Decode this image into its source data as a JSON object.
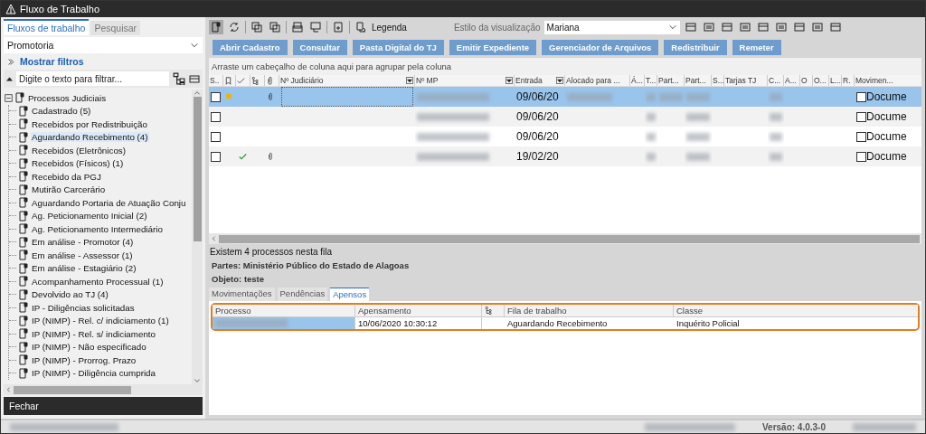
{
  "window": {
    "title": "Fluxo de Trabalho"
  },
  "left_panel": {
    "tabs": [
      {
        "label": "Fluxos de trabalho",
        "selected": true
      },
      {
        "label": "Pesquisar",
        "selected": false
      }
    ],
    "queue_select": {
      "value": "Promotoria"
    },
    "filters_link": "Mostrar filtros",
    "filter_field": {
      "placeholder": "Digite o texto para filtrar..."
    },
    "tree": {
      "label": "Processos Judiciais",
      "expanded": true,
      "children": [
        {
          "label": "Cadastrado (5)",
          "selected": false
        },
        {
          "label": "Recebidos por Redistribuição",
          "selected": false
        },
        {
          "label": "Aguardando Recebimento (4)",
          "selected": true
        },
        {
          "label": "Recebidos (Eletrônicos)",
          "selected": false
        },
        {
          "label": "Recebidos (Físicos) (1)",
          "selected": false
        },
        {
          "label": "Recebido da PGJ",
          "selected": false
        },
        {
          "label": "Mutirão Carcerário",
          "selected": false
        },
        {
          "label": "Aguardando Portaria de Atuação Conju",
          "selected": false
        },
        {
          "label": "Ag. Peticionamento Inicial (2)",
          "selected": false
        },
        {
          "label": "Ag. Peticionamento Intermediário",
          "selected": false
        },
        {
          "label": "Em análise - Promotor (4)",
          "selected": false
        },
        {
          "label": "Em análise - Assessor (1)",
          "selected": false
        },
        {
          "label": "Em análise - Estagiário (2)",
          "selected": false
        },
        {
          "label": "Acompanhamento Processual (1)",
          "selected": false
        },
        {
          "label": "Devolvido ao TJ (4)",
          "selected": false
        },
        {
          "label": "IP - Diligências solicitadas",
          "selected": false
        },
        {
          "label": "IP (NIMP) - Rel. c/ indiciamento (1)",
          "selected": false
        },
        {
          "label": "IP (NIMP) - Rel. s/ indiciamento",
          "selected": false
        },
        {
          "label": "IP (NIMP) - Não especificado",
          "selected": false
        },
        {
          "label": "IP (NIMP) - Prorrog. Prazo",
          "selected": false
        },
        {
          "label": "IP (NIMP) - Diligência cumprida",
          "selected": false
        }
      ]
    },
    "close_button": "Fechar"
  },
  "toolbar": {
    "legend_label": "Legenda",
    "style_label": "Estilo da visualização",
    "style_select": {
      "value": "Mariana"
    }
  },
  "action_buttons": [
    "Abrir Cadastro",
    "Consultar",
    "Pasta Digital do TJ",
    "Emitir Expediente",
    "Gerenciador de Arquivos",
    "Redistribuir",
    "Remeter"
  ],
  "grid": {
    "group_hint": "Arraste um cabeçalho de coluna aqui para agrupar pela coluna",
    "columns": [
      {
        "kind": "text",
        "label": "S.."
      },
      {
        "kind": "icon"
      },
      {
        "kind": "icon"
      },
      {
        "kind": "icon"
      },
      {
        "kind": "icon"
      },
      {
        "kind": "text",
        "label": "Nº Judiciário"
      },
      {
        "kind": "text",
        "label": "Nº MP"
      },
      {
        "kind": "text",
        "label": "Entrada"
      },
      {
        "kind": "text",
        "label": "Alocado para ..."
      },
      {
        "kind": "text",
        "label": "Á..."
      },
      {
        "kind": "text",
        "label": "T..."
      },
      {
        "kind": "text",
        "label": "Part..."
      },
      {
        "kind": "text",
        "label": "Part..."
      },
      {
        "kind": "text",
        "label": "S..."
      },
      {
        "kind": "text",
        "label": "Tarjas TJ"
      },
      {
        "kind": "text",
        "label": "C..."
      },
      {
        "kind": "text",
        "label": "A..."
      },
      {
        "kind": "text",
        "label": "O"
      },
      {
        "kind": "text",
        "label": "O..."
      },
      {
        "kind": "text",
        "label": "L..."
      },
      {
        "kind": "text",
        "label": "R."
      },
      {
        "kind": "text",
        "label": "Movimen..."
      }
    ],
    "rows": [
      {
        "selected": true,
        "checked": false,
        "flagged": true,
        "done": false,
        "attached": true,
        "entrada": "09/06/20",
        "movement": {
          "checked": false,
          "label": "Docume"
        }
      },
      {
        "selected": false,
        "checked": false,
        "flagged": false,
        "done": false,
        "attached": false,
        "entrada": "09/06/20",
        "movement": {
          "checked": false,
          "label": "Docume"
        }
      },
      {
        "selected": false,
        "checked": false,
        "flagged": false,
        "done": false,
        "attached": false,
        "entrada": "09/06/20",
        "movement": {
          "checked": false,
          "label": "Docume"
        }
      },
      {
        "selected": false,
        "checked": false,
        "flagged": false,
        "done": true,
        "attached": true,
        "entrada": "19/02/20",
        "movement": {
          "checked": false,
          "label": "Docume"
        }
      }
    ]
  },
  "details": {
    "count_text": "Existem 4 processos nesta fila",
    "parties": "Partes: Ministério Público do Estado de Alagoas",
    "object": "Objeto: teste",
    "tabs": [
      {
        "label": "Movimentações",
        "selected": false
      },
      {
        "label": "Pendências",
        "selected": false
      },
      {
        "label": "Apensos",
        "selected": true
      }
    ],
    "attachments": {
      "columns": [
        {
          "kind": "text",
          "label": "Processo"
        },
        {
          "kind": "text",
          "label": "Apensamento"
        },
        {
          "kind": "icon"
        },
        {
          "kind": "text",
          "label": "Fila de trabalho"
        },
        {
          "kind": "text",
          "label": "Classe"
        }
      ],
      "rows": [
        {
          "apensamento": "10/06/2020 10:30:12",
          "queue": "Aguardando Recebimento",
          "class": "Inquérito Policial"
        }
      ]
    }
  },
  "status_bar": {
    "version": "Versão: 4.0.3-0"
  }
}
